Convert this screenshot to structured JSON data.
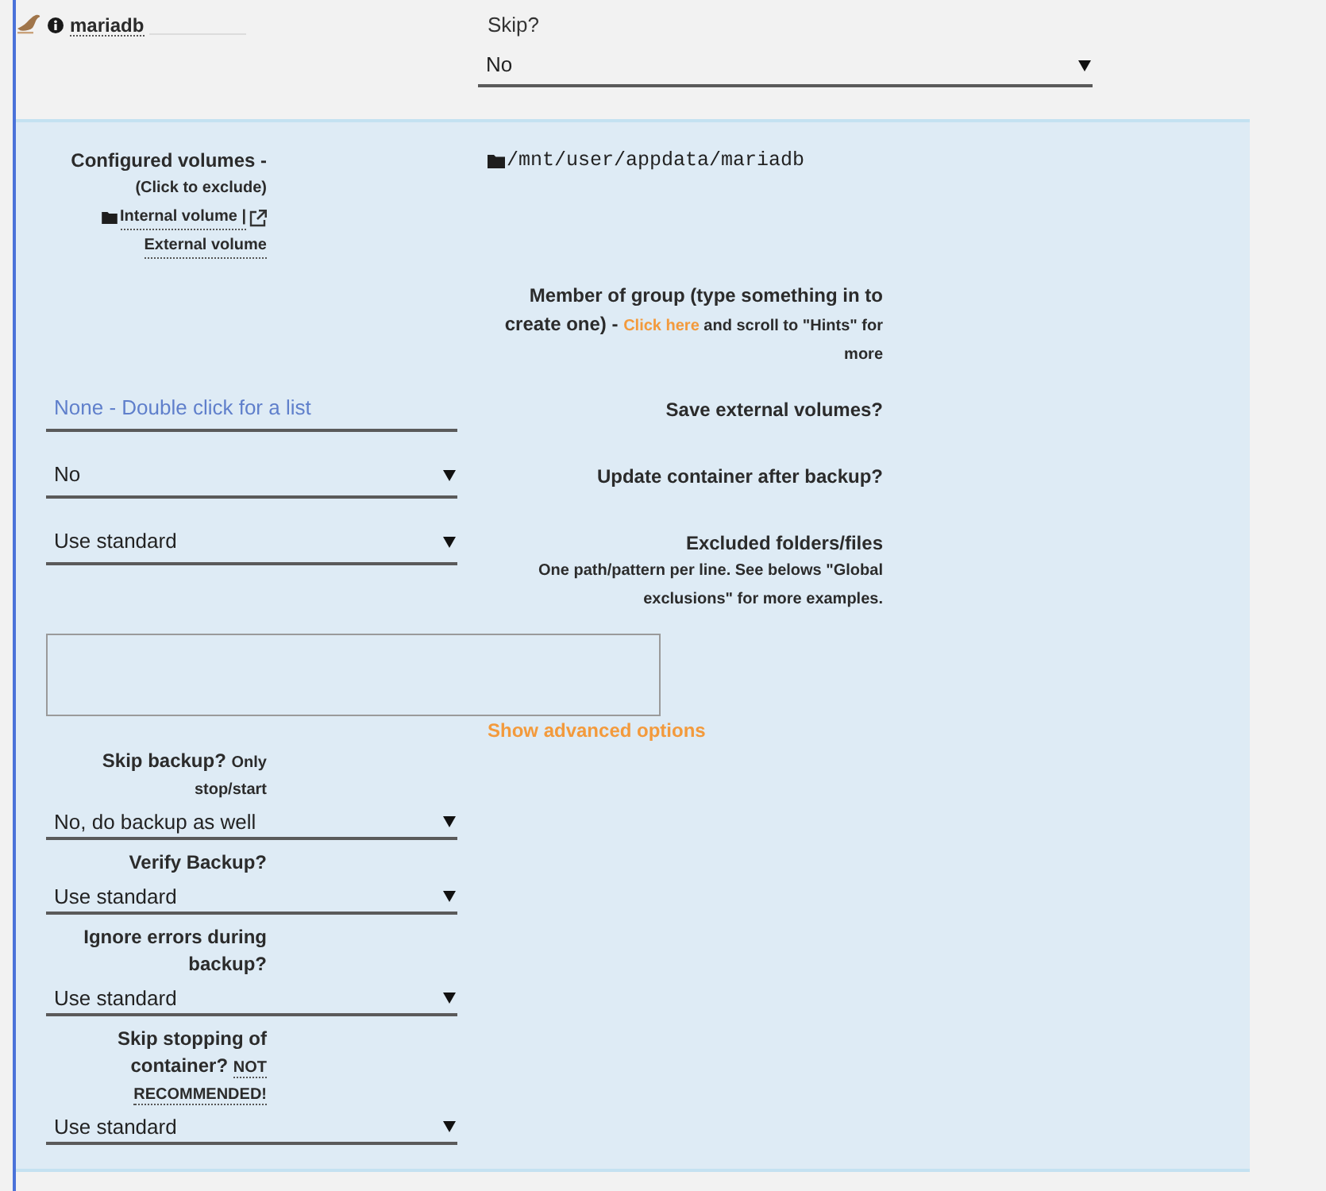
{
  "header": {
    "name": "mariadb",
    "skip_label": "Skip?",
    "skip_value": "No"
  },
  "volumes": {
    "label": "Configured volumes -",
    "hint": "(Click to exclude)",
    "internal_legend": "Internal volume |",
    "external_legend": "External volume",
    "path": "/mnt/user/appdata/mariadb"
  },
  "group": {
    "label": "Member of group (type something in to create one) -",
    "link": "Click here",
    "hint": "and scroll to \"Hints\" for more",
    "placeholder": "None - Double click for a list"
  },
  "save_external": {
    "label": "Save external volumes?",
    "value": "No"
  },
  "update_container": {
    "label": "Update container after backup?",
    "value": "Use standard"
  },
  "excluded": {
    "label": "Excluded folders/files",
    "hint": "One path/pattern per line. See belows \"Global exclusions\" for more examples."
  },
  "advanced_link": "Show advanced options",
  "advanced": [
    {
      "label": "Skip backup?",
      "hint": "Only stop/start",
      "value": "No, do backup as well"
    },
    {
      "label": "Verify Backup?",
      "value": "Use standard"
    },
    {
      "label": "Ignore errors during backup?",
      "value": "Use standard"
    },
    {
      "label": "Skip stopping of container?",
      "warning": "NOT RECOMMENDED!",
      "value": "Use standard"
    }
  ]
}
